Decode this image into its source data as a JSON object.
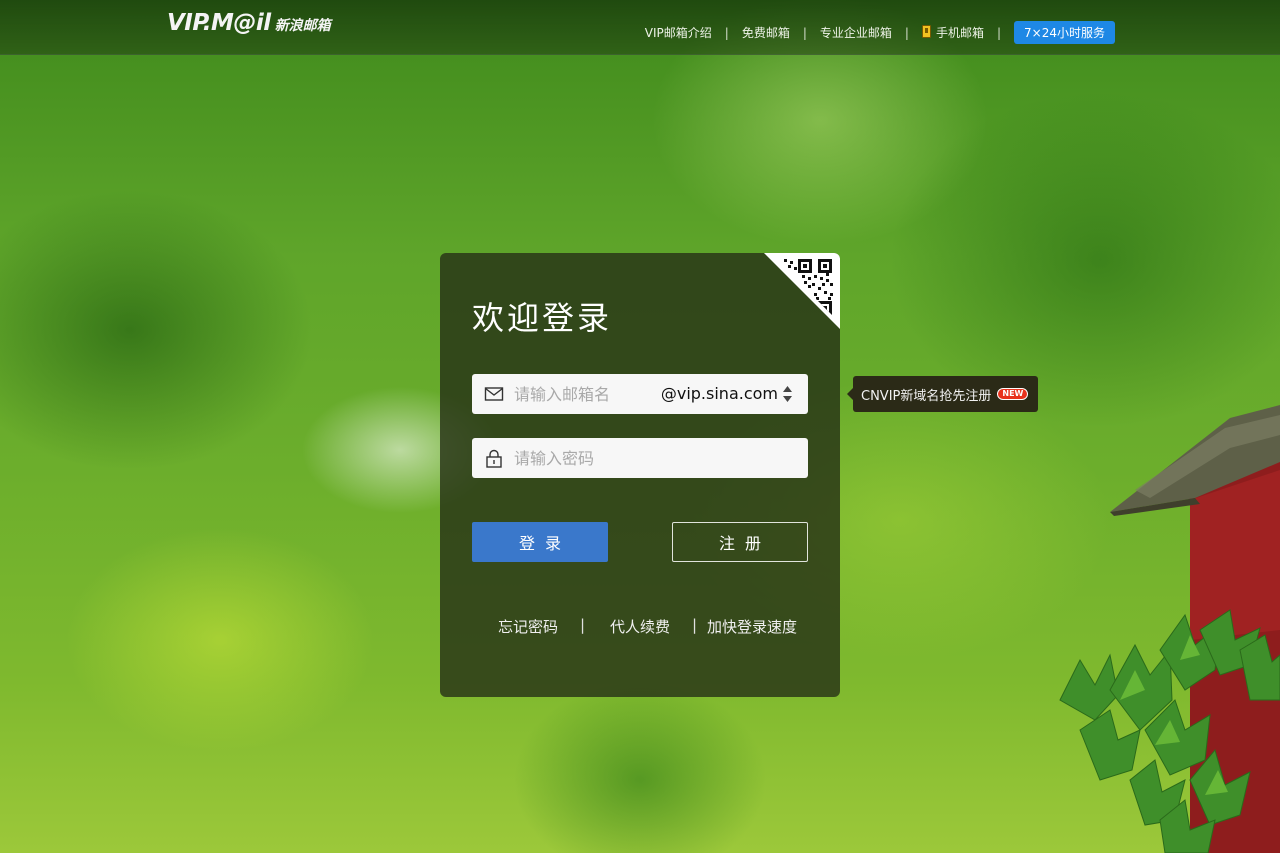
{
  "header": {
    "logo_main": "VIP.M@il",
    "logo_sub": "新浪邮箱",
    "nav": [
      {
        "label": "VIP邮箱介绍"
      },
      {
        "label": "免费邮箱"
      },
      {
        "label": "专业企业邮箱"
      },
      {
        "label": "手机邮箱",
        "icon": "phone-icon"
      }
    ],
    "separator": "|",
    "service_label": "7×24小时服务",
    "service_color": "#1e88e5"
  },
  "login": {
    "title": "欢迎登录",
    "email_placeholder": "请输入邮箱名",
    "email_value": "",
    "domain": "@vip.sina.com",
    "password_placeholder": "请输入密码",
    "password_value": "",
    "login_label": "登录",
    "register_label": "注册",
    "login_color": "#3a78cb",
    "links": [
      {
        "label": "忘记密码"
      },
      {
        "label": "代人续费"
      },
      {
        "label": "加快登录速度"
      }
    ],
    "links_separator": "|"
  },
  "tooltip": {
    "text": "CNVIP新域名抢先注册",
    "badge": "NEW",
    "badge_color": "#e8321c"
  },
  "icons": {
    "email": "mail-icon",
    "password": "lock-icon",
    "domain_toggle": "sort-arrows-icon",
    "qr": "qr-code-icon"
  }
}
